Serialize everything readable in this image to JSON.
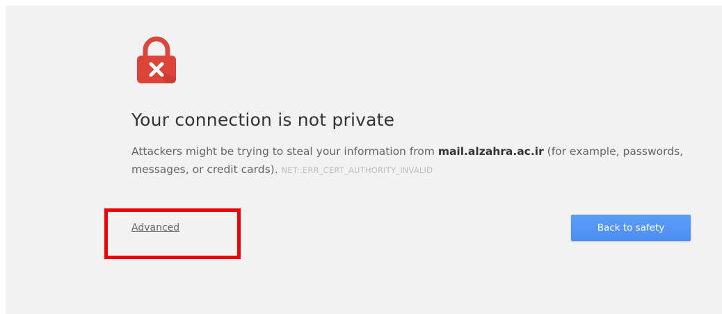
{
  "page": {
    "title": "Your connection is not private",
    "message_prefix": "Attackers might be trying to steal your information from ",
    "domain": "mail.alzahra.ac.ir",
    "message_suffix": " (for example, passwords, messages, or credit cards). ",
    "error_code": "NET::ERR_CERT_AUTHORITY_INVALID",
    "advanced_label": "Advanced",
    "back_button_label": "Back to safety",
    "icon": "lock-error-icon"
  },
  "colors": {
    "background": "#f2f2f2",
    "lock_red": "#db4437",
    "button_blue": "#4d90fe",
    "highlight_red": "#ee0000"
  }
}
